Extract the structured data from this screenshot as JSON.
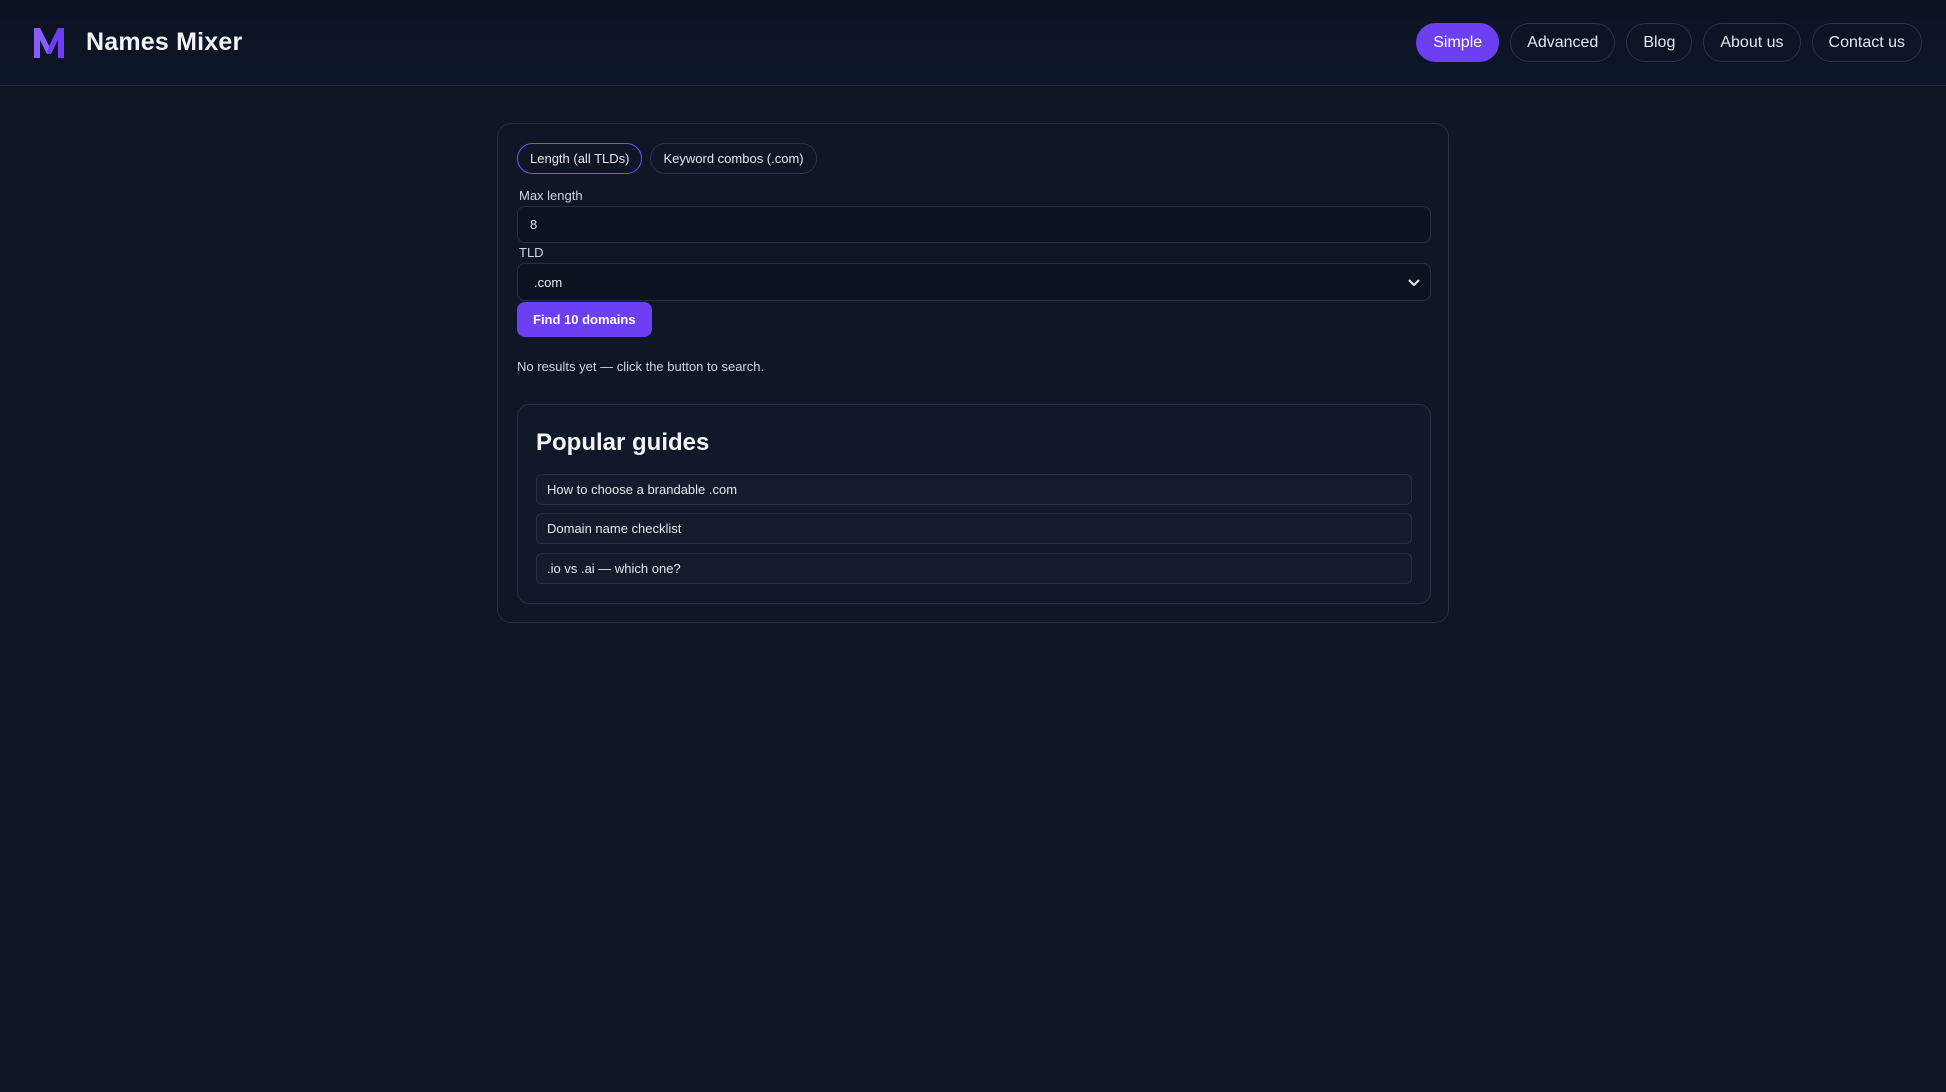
{
  "header": {
    "brand_name": "Names Mixer",
    "logo_icon": "nm-logo-icon",
    "nav": [
      {
        "label": "Simple",
        "active": true
      },
      {
        "label": "Advanced",
        "active": false
      },
      {
        "label": "Blog",
        "active": false
      },
      {
        "label": "About us",
        "active": false
      },
      {
        "label": "Contact us",
        "active": false
      }
    ]
  },
  "search": {
    "tabs": [
      {
        "label": "Length (all TLDs)",
        "active": true
      },
      {
        "label": "Keyword combos (.com)",
        "active": false
      }
    ],
    "max_length_label": "Max length",
    "max_length_value": "8",
    "tld_label": "TLD",
    "tld_value": ".com",
    "submit_label": "Find 10 domains",
    "status": "No results yet — click the button to search."
  },
  "guides": {
    "title": "Popular guides",
    "items": [
      "How to choose a brandable .com",
      "Domain name checklist",
      ".io vs .ai — which one?"
    ]
  },
  "colors": {
    "accent": "#6d3ff2",
    "background": "#0f1624",
    "header_background": "#0b1222"
  }
}
